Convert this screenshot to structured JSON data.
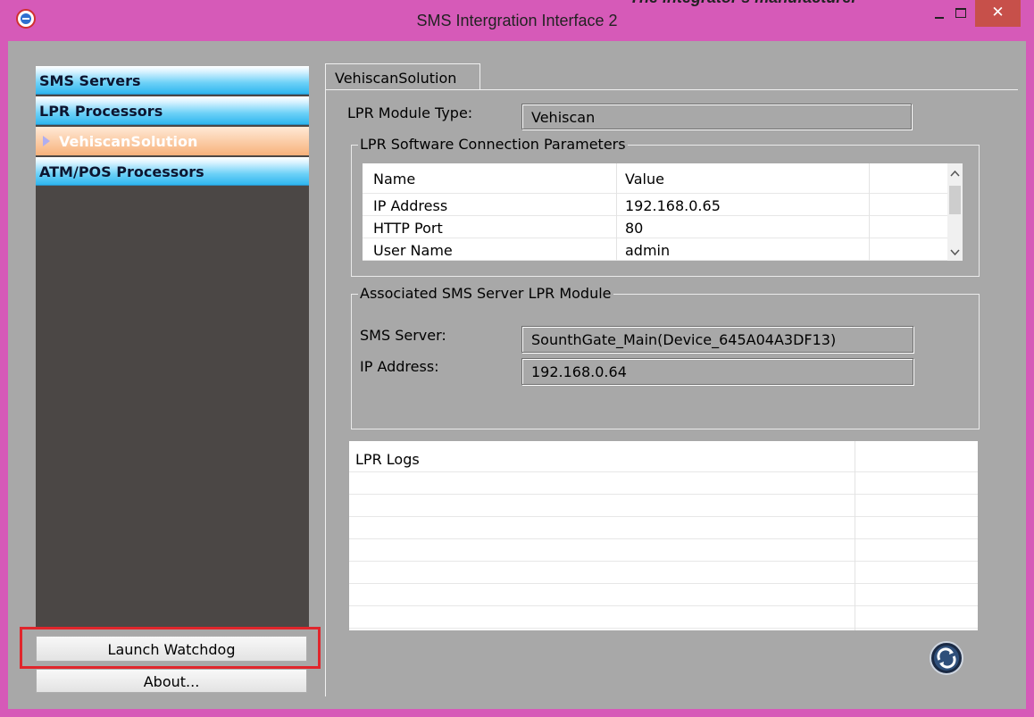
{
  "window": {
    "title": "SMS Intergration Interface 2",
    "overflow_caption": "The integrator's manufacturer",
    "accent_color": "#d65ab8",
    "close_glyph": "✕"
  },
  "nav": {
    "items": [
      {
        "label": "SMS Servers"
      },
      {
        "label": "LPR Processors"
      },
      {
        "label": "VehiscanSolution"
      },
      {
        "label": "ATM/POS Processors"
      }
    ],
    "launch_watchdog_label": "Launch Watchdog",
    "about_label": "About..."
  },
  "tabs": [
    {
      "label": "VehiscanSolution",
      "selected": true
    }
  ],
  "lpr_module": {
    "type_label": "LPR Module Type:",
    "type_value": "Vehiscan"
  },
  "connection": {
    "title": "LPR Software Connection Parameters",
    "columns": [
      "Name",
      "Value"
    ],
    "rows": [
      {
        "name": "IP Address",
        "value": "192.168.0.65"
      },
      {
        "name": "HTTP Port",
        "value": "80"
      },
      {
        "name": "User Name",
        "value": "admin"
      }
    ]
  },
  "associated": {
    "title": "Associated SMS Server LPR Module",
    "server_label": "SMS Server:",
    "server_value": "SounthGate_Main(Device_645A04A3DF13)",
    "ip_label": "IP Address:",
    "ip_value": "192.168.0.64"
  },
  "logs": {
    "header": "LPR Logs"
  },
  "icons": {
    "app": "app-logo-icon",
    "refresh": "refresh-icon"
  }
}
